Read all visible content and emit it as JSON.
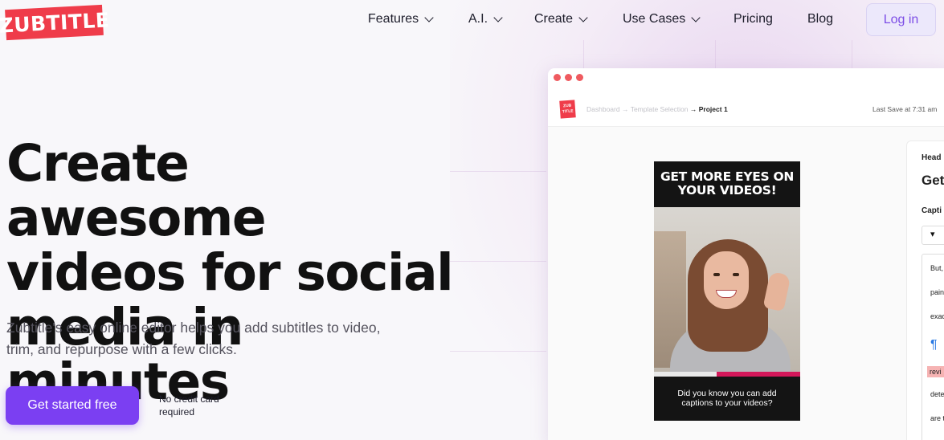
{
  "brand": {
    "logo_text": "ZUBTITLE",
    "accent": "#ef3c4a",
    "primary": "#7b3ff2"
  },
  "nav": {
    "items": [
      {
        "label": "Features",
        "has_dropdown": true
      },
      {
        "label": "A.I.",
        "has_dropdown": true
      },
      {
        "label": "Create",
        "has_dropdown": true
      },
      {
        "label": "Use Cases",
        "has_dropdown": true
      },
      {
        "label": "Pricing",
        "has_dropdown": false
      },
      {
        "label": "Blog",
        "has_dropdown": false
      }
    ],
    "login_label": "Log in"
  },
  "hero": {
    "title": "Create awesome videos for social media in minutes",
    "subtitle": "Zubtitle's easy online editor helps you add subtitles to video, trim, and repurpose with a few clicks.",
    "cta_label": "Get started free",
    "cta_note": "No credit card required"
  },
  "app_mock": {
    "mini_logo_top": "ZUB",
    "mini_logo_bottom": "TITLE",
    "breadcrumb": [
      "Dashboard",
      "Template Selection",
      "Project 1"
    ],
    "last_save": "Last Save at 7:31 am",
    "video_headline": "GET MORE EYES ON YOUR VIDEOS!",
    "video_caption": "Did you know you can add captions to your videos?",
    "playback_progress": 0.43,
    "panel": {
      "heading_label": "Head",
      "heading_value": "Get",
      "captions_label": "Capti",
      "lines": [
        "But,",
        "pain",
        "exac",
        "revi",
        "dete",
        "are t"
      ]
    }
  }
}
